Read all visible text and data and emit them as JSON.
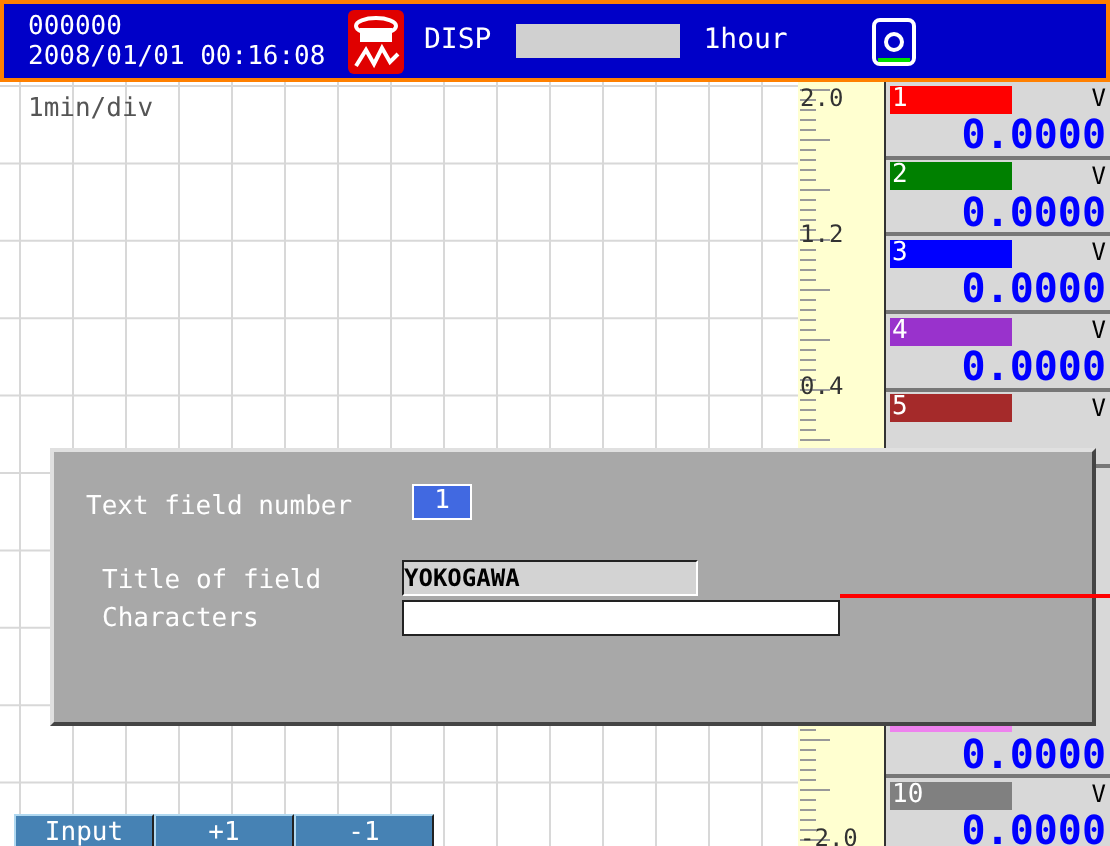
{
  "header": {
    "counter": "000000",
    "datetime": "2008/01/01 00:16:08",
    "mode": "DISP",
    "span": "1hour"
  },
  "chart": {
    "time_div": "1min/div",
    "scale_labels": [
      "2.0",
      "1.2",
      "0.4",
      "-2.0"
    ]
  },
  "channels": [
    {
      "kind": "full",
      "number": "1",
      "color": "#ff0000",
      "unit": "V",
      "value": "0.0000"
    },
    {
      "kind": "full",
      "number": "2",
      "color": "#008000",
      "unit": "V",
      "value": "0.0000"
    },
    {
      "kind": "full",
      "number": "3",
      "color": "#0000ff",
      "unit": "V",
      "value": "0.0000"
    },
    {
      "kind": "full",
      "number": "4",
      "color": "#9932cc",
      "unit": "V",
      "value": "0.0000"
    },
    {
      "kind": "full",
      "number": "5",
      "color": "#a52a2a",
      "unit": "V"
    },
    {
      "kind": "covered"
    },
    {
      "kind": "covered"
    },
    {
      "kind": "covered"
    },
    {
      "kind": "full",
      "color": "#ee82ee",
      "value": "0.0000"
    },
    {
      "kind": "full",
      "number": "10",
      "color": "#808080",
      "unit": "V",
      "value": "0.0000"
    }
  ],
  "dialog": {
    "number_label": "Text field number",
    "number_value": "1",
    "title_label": "Title of field",
    "title_value": "YOKOGAWA",
    "chars_label": "Characters"
  },
  "softkeys": [
    "Input",
    "+1",
    "-1"
  ]
}
